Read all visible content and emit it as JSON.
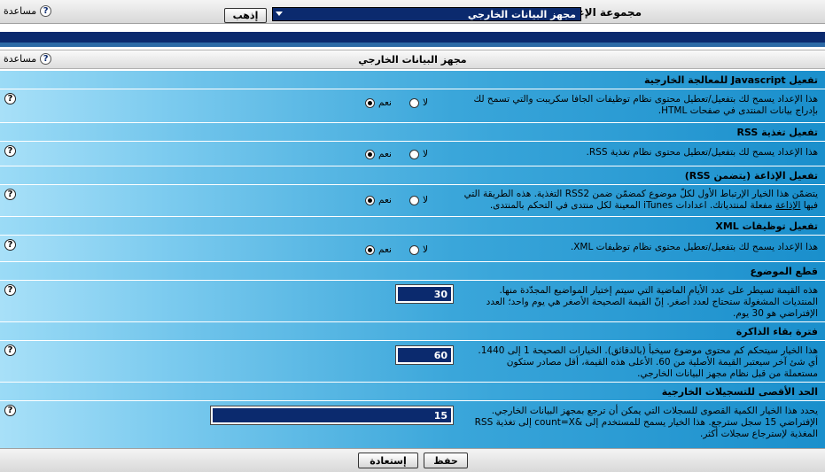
{
  "topbar": {
    "help_label": "مساعدة",
    "group_label": "مجموعة الإعداد",
    "group_selected": "مجهز البيانات الخارجي",
    "go_label": "إذهب"
  },
  "section": {
    "title": "مجهز البيانات الخارجي",
    "help_label": "مساعدة"
  },
  "radio_labels": {
    "yes": "نعم",
    "no": "لا"
  },
  "settings": [
    {
      "title": "تفعيل Javascript للمعالجة الخارجية",
      "lines": [
        "هذا الإعداد يسمح لك بتفعيل/تعطيل محتوى نظام توظيفات الجافا سكريبت والتي تسمح لك",
        "بإدراج بيانات المنتدى في صفحات HTML."
      ],
      "value": "yes"
    },
    {
      "title": "تفعيل تغذية RSS",
      "lines": [
        "هذا الإعداد يسمح لك بتفعيل/تعطيل محتوى نظام تغذية RSS."
      ],
      "value": "yes"
    },
    {
      "title": "تفعيل الإذاعة (يتضمن RSS)",
      "lines": [
        "يتضمّن هذا الخيار الإرتباط الأول لكلّ موضوع كمضمّن ضمن RSS2 التغذية. هذه الطريقة التي",
        "فيها الإذاعة مفعلة لمنتدياتك. اعدادات iTunes المعينة لكل منتدى في التحكم بالمنتدى."
      ],
      "underline": "الإذاعة",
      "value": "yes"
    },
    {
      "title": "تفعيل توظيفات XML",
      "lines": [
        "هذا الإعداد يسمح لك بتفعيل/تعطيل محتوى نظام توظيفات XML."
      ],
      "value": "yes"
    },
    {
      "title": "قطع الموضوع",
      "lines": [
        "هذه القيمة تسيطر على عدد الأيام الماضية التي سيتم إختيار المواضيع المجدّدة منها.",
        "المنتديات المشغولة ستحتاج لعدد أصغر. إنّ القيمة الصحيحة الأصغر هي يوم واحد؛ العدد",
        "الإفتراضي هو 30 يوم."
      ],
      "input": "30"
    },
    {
      "title": "فترة بقاء الذاكرة",
      "lines": [
        "هذا الخيار سيتحكم كم محتوى موضوع سيخبأ (بالدقائق). الخيارات الصحيحة 1 إلى 1440.",
        "أي شئ آخر سيعتبر القيمة الأصلية من 60. الأعلى هذه القيمة، أقل مصادر ستكون",
        "مستعملة من قبل نظام مجهز البيانات الخارجي."
      ],
      "input": "60"
    },
    {
      "title": "الحد الأقصى للتسجيلات الخارجية",
      "lines": [
        "يحدد هذا الخيار الكمية القصوى للسجلات التي يمكن أن ترجع بمجهز البيانات الخارجي.",
        "الإفتراضي 15 سجل سترجع. هذا الخيار يسمح للمستخدم إلى &count=X إلى تغذية RSS",
        "المغذية لإسترجاع سجلات أكثر."
      ],
      "input": "15"
    }
  ],
  "footer": {
    "save_label": "حفظ",
    "reset_label": "إستعادة"
  },
  "colors": {
    "navy": "#0b2a6e",
    "cyan_dark": "#1a8fcc",
    "cyan_light": "#9bdbf6"
  }
}
